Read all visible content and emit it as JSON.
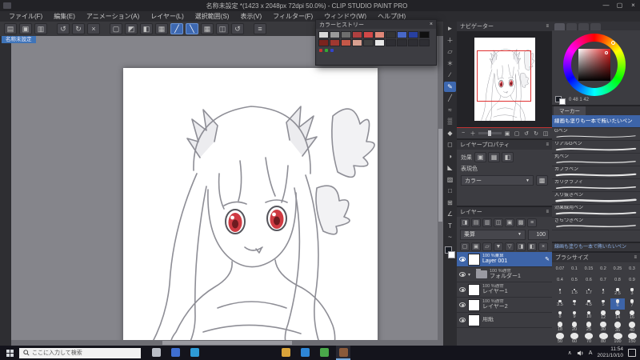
{
  "window": {
    "title": "名称未設定 *(1423 x 2048px 72dpi 50.0%) - CLIP STUDIO PAINT PRO"
  },
  "menu": {
    "items": [
      "ファイル(F)",
      "編集(E)",
      "アニメーション(A)",
      "レイヤー(L)",
      "選択範囲(S)",
      "表示(V)",
      "フィルター(F)",
      "ウィンドウ(W)",
      "ヘルプ(H)"
    ]
  },
  "toolbar": {
    "icons": [
      {
        "name": "new-file-icon",
        "glyph": "▤"
      },
      {
        "name": "open-file-icon",
        "glyph": "▣"
      },
      {
        "name": "save-icon",
        "glyph": "▥"
      },
      {
        "name": "undo-icon",
        "glyph": "↺",
        "gap_before": true
      },
      {
        "name": "redo-icon",
        "glyph": "↻"
      },
      {
        "name": "clear-icon",
        "glyph": "×"
      },
      {
        "name": "deselect-icon",
        "glyph": "▢",
        "gap_before": true
      },
      {
        "name": "reselect-icon",
        "glyph": "◩"
      },
      {
        "name": "invert-selection-icon",
        "glyph": "◧"
      },
      {
        "name": "selection-border-icon",
        "glyph": "▦"
      },
      {
        "name": "snap-to-ruler-icon",
        "glyph": "╱",
        "active": true
      },
      {
        "name": "snap-to-special-ruler-icon",
        "glyph": "╲",
        "active": true
      },
      {
        "name": "snap-to-grid-icon",
        "glyph": "▦"
      },
      {
        "name": "flip-view-icon",
        "glyph": "◫"
      },
      {
        "name": "rotate-view-icon",
        "glyph": "↺"
      },
      {
        "name": "palette-dock-icon",
        "glyph": "≡",
        "gap_before": true
      }
    ]
  },
  "doc_tab": "名称未設定",
  "color_history": {
    "title": "カラーヒストリー",
    "swatches": [
      "#d8d8d8",
      "#9a9a9a",
      "#6e6e6e",
      "#b04040",
      "#d04848",
      "#e08878",
      "#343434",
      "#4868c8",
      "#2840a0",
      "#101010",
      "#7a241e",
      "#a03830",
      "#c45848",
      "#d8a090",
      "#404040",
      "#e8e8e8",
      null,
      null,
      null,
      null
    ],
    "dots": [
      "#cc3333",
      "#33aa33",
      "#3344cc"
    ]
  },
  "tools": {
    "main_color": "#161a22",
    "sub_color": "#ffffff",
    "items": [
      {
        "name": "tool-operation",
        "glyph": "►"
      },
      {
        "name": "tool-move",
        "glyph": "＋"
      },
      {
        "name": "tool-selection",
        "glyph": "▱"
      },
      {
        "name": "tool-auto-select",
        "glyph": "＊"
      },
      {
        "name": "tool-eyedropper",
        "glyph": "∕"
      },
      {
        "name": "tool-pen",
        "glyph": "✎",
        "active": true
      },
      {
        "name": "tool-pencil",
        "glyph": "╱"
      },
      {
        "name": "tool-brush",
        "glyph": "≈"
      },
      {
        "name": "tool-airbrush",
        "glyph": "▒"
      },
      {
        "name": "tool-decoration",
        "glyph": "◆"
      },
      {
        "name": "tool-eraser",
        "glyph": "◻"
      },
      {
        "name": "tool-blend",
        "glyph": "◑"
      },
      {
        "name": "tool-fill",
        "glyph": "◣"
      },
      {
        "name": "tool-gradient",
        "glyph": "▨"
      },
      {
        "name": "tool-figure",
        "glyph": "□"
      },
      {
        "name": "tool-frame-border",
        "glyph": "⊞"
      },
      {
        "name": "tool-ruler",
        "glyph": "∠"
      },
      {
        "name": "tool-text",
        "glyph": "T"
      },
      {
        "name": "tool-line-correction",
        "glyph": "~"
      }
    ]
  },
  "panels": {
    "navigator": {
      "title": "ナビゲーター",
      "controls": [
        {
          "name": "nav-zoom-out-icon",
          "glyph": "−"
        },
        {
          "name": "nav-zoom-in-icon",
          "glyph": "＋"
        },
        {
          "name": "nav-fit-icon",
          "glyph": "▣"
        },
        {
          "name": "nav-actual-size-icon",
          "glyph": "▢"
        },
        {
          "name": "nav-rotate-left-icon",
          "glyph": "↺"
        },
        {
          "name": "nav-rotate-right-icon",
          "glyph": "↻"
        },
        {
          "name": "nav-flip-icon",
          "glyph": "◫"
        }
      ]
    },
    "color_wheel": {
      "values": "0 48 1 42"
    },
    "subtool": {
      "group_tab": "マーカー",
      "caption": "線画も塗りも一本で賄いたいペン",
      "brushes": [
        {
          "name": "線画も塗りも一本で賄いたいペン",
          "selected": true
        },
        {
          "name": "Gペン"
        },
        {
          "name": "リアルGペン"
        },
        {
          "name": "丸ペン"
        },
        {
          "name": "カブラペン"
        },
        {
          "name": "カリグラフィ"
        },
        {
          "name": "入り抜きペン"
        },
        {
          "name": "効果線用ペン"
        },
        {
          "name": "ざらつきペン"
        }
      ]
    },
    "layer_property": {
      "title": "レイヤープロパティ",
      "effect_label": "効果",
      "effect_icons": [
        {
          "name": "effect-border-icon",
          "glyph": "▣"
        },
        {
          "name": "effect-tone-icon",
          "glyph": "▦"
        },
        {
          "name": "effect-layer-color-icon",
          "glyph": "◧"
        }
      ],
      "expression_label": "表現色",
      "expression_value": "カラー"
    },
    "layers": {
      "title": "レイヤー",
      "top_icons": [
        {
          "name": "layer-filter-icon",
          "glyph": "◨"
        },
        {
          "name": "layer-thumbnail-icon",
          "glyph": "▤"
        },
        {
          "name": "layer-tone-icon",
          "glyph": "▥"
        },
        {
          "name": "layer-mask-icon",
          "glyph": "◫"
        },
        {
          "name": "layer-palette-icon",
          "glyph": "▣"
        },
        {
          "name": "layer-effect-icon",
          "glyph": "▩"
        },
        {
          "name": "layer-menu-icon",
          "glyph": "≡"
        }
      ],
      "blend_mode": "乗算",
      "opacity": "100",
      "row_icons": [
        {
          "name": "new-raster-layer-icon",
          "glyph": "▢"
        },
        {
          "name": "new-vector-layer-icon",
          "glyph": "▣"
        },
        {
          "name": "new-folder-icon",
          "glyph": "▱"
        },
        {
          "name": "transfer-to-lower-icon",
          "glyph": "▼"
        },
        {
          "name": "combine-to-lower-icon",
          "glyph": "▽"
        },
        {
          "name": "layer-mask-create-icon",
          "glyph": "◨"
        },
        {
          "name": "apply-mask-icon",
          "glyph": "◧"
        },
        {
          "name": "delete-layer-icon",
          "glyph": "×"
        }
      ],
      "items": [
        {
          "info": "100 %乗算",
          "name": "Layer 001",
          "type": "layer",
          "selected": true
        },
        {
          "info": "100 %通常",
          "name": "フォルダー1",
          "type": "folder"
        },
        {
          "info": "100 %通常",
          "name": "レイヤー1",
          "type": "layer"
        },
        {
          "info": "100 %通常",
          "name": "レイヤー2",
          "type": "layer"
        },
        {
          "info": "",
          "name": "用紙",
          "type": "paper"
        }
      ]
    },
    "brush_size": {
      "title": "ブラシサイズ",
      "selected": 6,
      "values": [
        0.07,
        0.1,
        0.15,
        0.2,
        0.25,
        0.3,
        0.4,
        0.5,
        0.6,
        0.7,
        0.8,
        0.9,
        1,
        1.5,
        1.7,
        2,
        2.5,
        3,
        3.5,
        4,
        4.5,
        5,
        6,
        7,
        8,
        9,
        10,
        12,
        14,
        16,
        18,
        20,
        25,
        30,
        35,
        40,
        50,
        60,
        70,
        80,
        100,
        150
      ]
    }
  },
  "taskbar": {
    "search_placeholder": "ここに入力して検索",
    "apps": [
      {
        "name": "task-view-button",
        "color": "#b9bdc6"
      },
      {
        "name": "mail-app-button",
        "color": "#3f6fd0"
      },
      {
        "name": "store-app-button",
        "color": "#2e9bd6"
      },
      {
        "name": "file-explorer-button",
        "color": "#d9a33a",
        "gap_before": true
      },
      {
        "name": "edge-browser-button",
        "color": "#2e86d6"
      },
      {
        "name": "browser-button",
        "color": "#4aa84a"
      },
      {
        "name": "clip-studio-paint-button",
        "color": "#8a5a3a",
        "active": true
      }
    ],
    "ime": "A",
    "time": "11:54",
    "date": "2021/10/10"
  }
}
